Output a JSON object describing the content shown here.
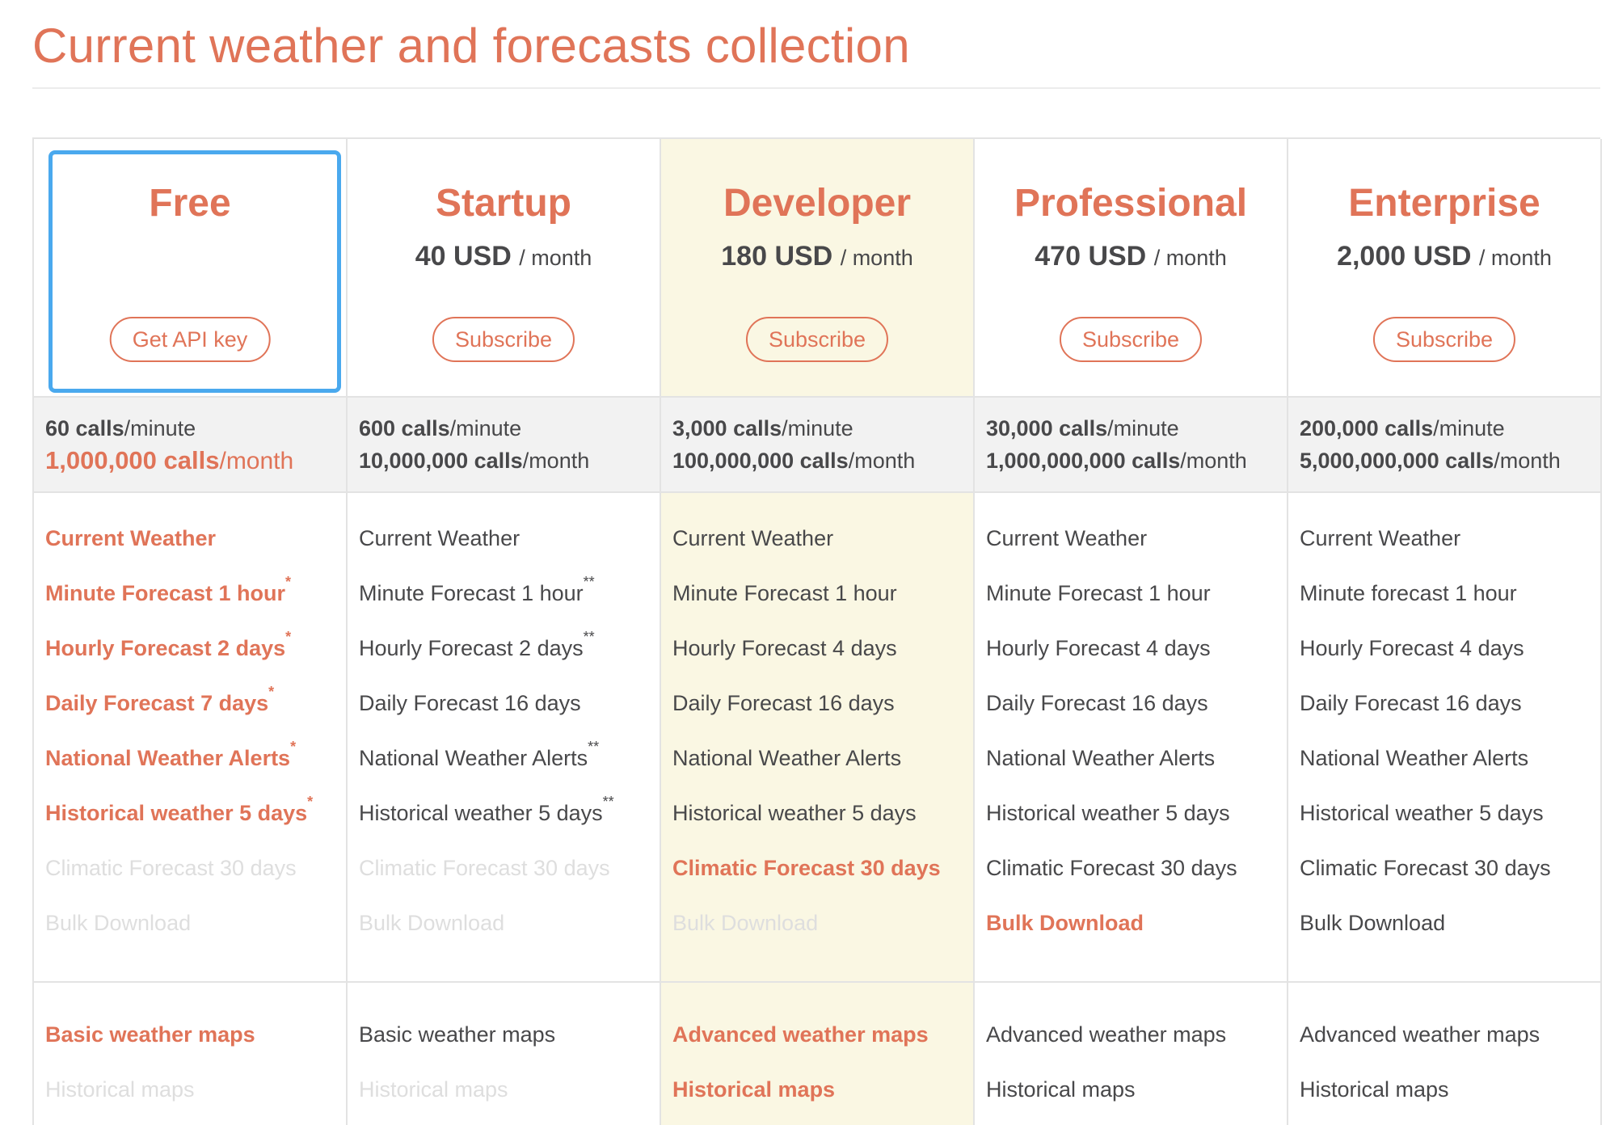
{
  "page": {
    "title": "Current weather and forecasts collection"
  },
  "plans": [
    {
      "name": "Free",
      "price": "",
      "per": "",
      "button": "Get API key",
      "calls_minute": {
        "value": "60 calls",
        "unit": "/minute"
      },
      "calls_month": {
        "value": "1,000,000 calls",
        "unit": "/month"
      },
      "features": [
        {
          "text": "Current Weather",
          "sup": ""
        },
        {
          "text": "Minute Forecast 1 hour",
          "sup": "*"
        },
        {
          "text": "Hourly Forecast 2 days",
          "sup": "*"
        },
        {
          "text": "Daily Forecast 7 days",
          "sup": "*"
        },
        {
          "text": "National Weather Alerts",
          "sup": "*"
        },
        {
          "text": "Historical weather 5 days",
          "sup": "*"
        },
        {
          "text": "Climatic Forecast 30 days",
          "sup": ""
        },
        {
          "text": "Bulk Download",
          "sup": ""
        }
      ],
      "maps": [
        {
          "text": "Basic weather maps"
        },
        {
          "text": "Historical maps"
        }
      ]
    },
    {
      "name": "Startup",
      "price": "40 USD",
      "per": "/ month",
      "button": "Subscribe",
      "calls_minute": {
        "value": "600 calls",
        "unit": "/minute"
      },
      "calls_month": {
        "value": "10,000,000 calls",
        "unit": "/month"
      },
      "features": [
        {
          "text": "Current Weather",
          "sup": ""
        },
        {
          "text": "Minute Forecast 1 hour",
          "sup": "**"
        },
        {
          "text": "Hourly Forecast 2 days",
          "sup": "**"
        },
        {
          "text": "Daily Forecast 16 days",
          "sup": ""
        },
        {
          "text": "National Weather Alerts",
          "sup": "**"
        },
        {
          "text": "Historical weather 5 days",
          "sup": "**"
        },
        {
          "text": "Climatic Forecast 30 days",
          "sup": ""
        },
        {
          "text": "Bulk Download",
          "sup": ""
        }
      ],
      "maps": [
        {
          "text": "Basic weather maps"
        },
        {
          "text": "Historical maps"
        }
      ]
    },
    {
      "name": "Developer",
      "price": "180 USD",
      "per": "/ month",
      "button": "Subscribe",
      "calls_minute": {
        "value": "3,000 calls",
        "unit": "/minute"
      },
      "calls_month": {
        "value": "100,000,000 calls",
        "unit": "/month"
      },
      "features": [
        {
          "text": "Current Weather",
          "sup": ""
        },
        {
          "text": "Minute Forecast 1 hour",
          "sup": ""
        },
        {
          "text": "Hourly Forecast 4 days",
          "sup": ""
        },
        {
          "text": "Daily Forecast 16 days",
          "sup": ""
        },
        {
          "text": "National Weather Alerts",
          "sup": ""
        },
        {
          "text": "Historical weather 5 days",
          "sup": ""
        },
        {
          "text": "Climatic Forecast 30 days",
          "sup": ""
        },
        {
          "text": "Bulk Download",
          "sup": ""
        }
      ],
      "maps": [
        {
          "text": "Advanced weather maps"
        },
        {
          "text": "Historical maps"
        }
      ]
    },
    {
      "name": "Professional",
      "price": "470 USD",
      "per": "/ month",
      "button": "Subscribe",
      "calls_minute": {
        "value": "30,000 calls",
        "unit": "/minute"
      },
      "calls_month": {
        "value": "1,000,000,000 calls",
        "unit": "/month"
      },
      "features": [
        {
          "text": "Current Weather",
          "sup": ""
        },
        {
          "text": "Minute Forecast 1 hour",
          "sup": ""
        },
        {
          "text": "Hourly Forecast 4 days",
          "sup": ""
        },
        {
          "text": "Daily Forecast 16 days",
          "sup": ""
        },
        {
          "text": "National Weather Alerts",
          "sup": ""
        },
        {
          "text": "Historical weather 5 days",
          "sup": ""
        },
        {
          "text": "Climatic Forecast 30 days",
          "sup": ""
        },
        {
          "text": "Bulk Download",
          "sup": ""
        }
      ],
      "maps": [
        {
          "text": "Advanced weather maps"
        },
        {
          "text": "Historical maps"
        }
      ]
    },
    {
      "name": "Enterprise",
      "price": "2,000 USD",
      "per": "/ month",
      "button": "Subscribe",
      "calls_minute": {
        "value": "200,000 calls",
        "unit": "/minute"
      },
      "calls_month": {
        "value": "5,000,000,000 calls",
        "unit": "/month"
      },
      "features": [
        {
          "text": "Current Weather",
          "sup": ""
        },
        {
          "text": "Minute forecast 1 hour",
          "sup": ""
        },
        {
          "text": "Hourly Forecast 4 days",
          "sup": ""
        },
        {
          "text": "Daily Forecast 16 days",
          "sup": ""
        },
        {
          "text": "National Weather Alerts",
          "sup": ""
        },
        {
          "text": "Historical weather 5 days",
          "sup": ""
        },
        {
          "text": "Climatic Forecast 30 days",
          "sup": ""
        },
        {
          "text": "Bulk Download",
          "sup": ""
        }
      ],
      "maps": [
        {
          "text": "Advanced weather maps"
        },
        {
          "text": "Historical maps"
        }
      ]
    }
  ],
  "colors": {
    "accent": "#e07458",
    "text": "#48484a",
    "disabled": "#dedede",
    "highlight": "#faf7e3",
    "selected_border": "#4aa9ee"
  }
}
